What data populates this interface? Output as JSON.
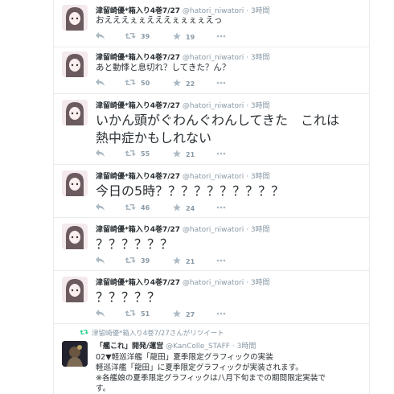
{
  "tweets": [
    {
      "name": "津留崎優*箱入り4巻7/27",
      "handle": "@hatori_niwatori",
      "dot": "·",
      "time": "3時間",
      "text": "おえええぇぇえええぇぇぇぇえっ",
      "retweets": "39",
      "favorites": "19"
    },
    {
      "name": "津留崎優*箱入り4巻7/27",
      "handle": "@hatori_niwatori",
      "dot": "·",
      "time": "3時間",
      "text": "あと動悸と息切れ？してきた？ん？",
      "retweets": "50",
      "favorites": "22"
    },
    {
      "name": "津留崎優*箱入り4巻7/27",
      "handle": "@hatori_niwatori",
      "dot": "·",
      "time": "3時間",
      "text_line1": "いかん頭がぐわんぐわんしてきた　これは",
      "text_line2": "熱中症かもしれない",
      "retweets": "55",
      "favorites": "21"
    },
    {
      "name": "津留崎優*箱入り4巻7/27",
      "handle": "@hatori_niwatori",
      "dot": "·",
      "time": "3時間",
      "text": "今日の5時？？？？？？？？？？",
      "retweets": "46",
      "favorites": "24"
    },
    {
      "name": "津留崎優*箱入り4巻7/27",
      "handle": "@hatori_niwatori",
      "dot": "·",
      "time": "3時間",
      "text": "？？？？？？",
      "retweets": "39",
      "favorites": "21"
    },
    {
      "name": "津留崎優*箱入り4巻7/27",
      "handle": "@hatori_niwatori",
      "dot": "·",
      "time": "3時間",
      "text": "？？？？？",
      "retweets": "51",
      "favorites": "27"
    }
  ],
  "retweet": {
    "context": "津留崎優*箱入り4巻7/27さんがリツイート",
    "name": "「艦これ」開発/運営",
    "handle": "@KanColle_STAFF",
    "dot": "·",
    "time": "3時間",
    "lines": [
      "02▼軽巡洋艦「龍田」夏季限定グラフィックの実装",
      "軽巡洋艦「龍田」に夏季限定グラフィックが実装されます。",
      "※各艦娘の夏季限定グラフィックは八月下旬までの期間限定実装で",
      "す。"
    ]
  },
  "icons": {
    "reply": "reply-icon",
    "retweet": "retweet-icon",
    "favorite": "star-icon",
    "more": "more-icon"
  },
  "colors": {
    "border": "#e6ecf0",
    "muted": "#8899a6",
    "text": "#292f33",
    "retweet_green": "#19cf86"
  }
}
